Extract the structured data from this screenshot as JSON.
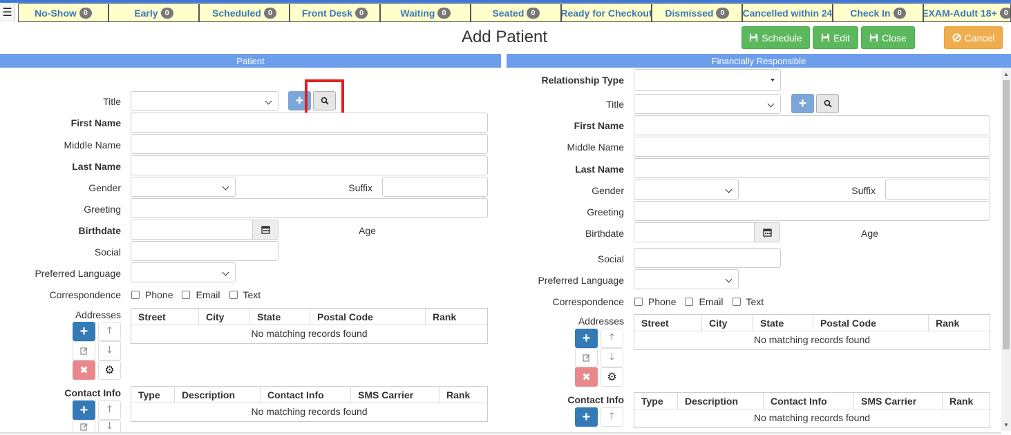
{
  "status_tabs": [
    {
      "label": "No-Show",
      "count": "0"
    },
    {
      "label": "Early",
      "count": "0"
    },
    {
      "label": "Scheduled",
      "count": "0"
    },
    {
      "label": "Front Desk",
      "count": "0"
    },
    {
      "label": "Waiting",
      "count": "0"
    },
    {
      "label": "Seated",
      "count": "0"
    },
    {
      "label": "Ready for Checkout",
      "count": ""
    },
    {
      "label": "Dismissed",
      "count": "0"
    },
    {
      "label": "Cancelled within 24",
      "count": ""
    },
    {
      "label": "Check In",
      "count": "0"
    },
    {
      "label": "EXAM-Adult 18+",
      "count": "0"
    }
  ],
  "page": {
    "title": "Add Patient",
    "menu_icon": "☰"
  },
  "actions": {
    "schedule": "Schedule",
    "edit": "Edit",
    "close": "Close",
    "cancel": "Cancel"
  },
  "sections": {
    "patient": "Patient",
    "financial": "Financially Responsible"
  },
  "patient": {
    "title": "Title",
    "first_name": "First Name",
    "middle_name": "Middle Name",
    "last_name": "Last Name",
    "gender": "Gender",
    "suffix": "Suffix",
    "greeting": "Greeting",
    "birthdate": "Birthdate",
    "age": "Age",
    "social": "Social",
    "preferred_language": "Preferred Language",
    "correspondence": "Correspondence",
    "corr_options": [
      "Phone",
      "Email",
      "Text"
    ],
    "addresses": "Addresses",
    "contact_info": "Contact Info"
  },
  "financial": {
    "relationship_type": "Relationship Type",
    "title": "Title",
    "first_name": "First Name",
    "middle_name": "Middle Name",
    "last_name": "Last Name",
    "gender": "Gender",
    "suffix": "Suffix",
    "greeting": "Greeting",
    "birthdate": "Birthdate",
    "age": "Age",
    "social": "Social",
    "preferred_language": "Preferred Language",
    "correspondence": "Correspondence",
    "corr_options": [
      "Phone",
      "Email",
      "Text"
    ],
    "addresses": "Addresses",
    "contact_info": "Contact Info"
  },
  "address_grid": {
    "columns": [
      "Street",
      "City",
      "State",
      "Postal Code",
      "Rank"
    ],
    "empty": "No matching records found"
  },
  "contact_grid": {
    "columns": [
      "Type",
      "Description",
      "Contact Info",
      "SMS Carrier",
      "Rank"
    ],
    "empty": "No matching records found"
  },
  "icons": {
    "plus": "+",
    "search": "search-icon",
    "calendar": "calendar-icon",
    "edit": "edit-icon",
    "delete": "✖",
    "up": "🡑",
    "down": "🡓",
    "settings": "⚙",
    "save": "save-icon",
    "ban": "ban-icon"
  },
  "colors": {
    "accent_blue": "#6d9eeb",
    "status_bg": "#ffffcc",
    "status_text": "#3e78b3",
    "green": "#5cb85c",
    "orange": "#f0ad4e",
    "highlight": "#e02020"
  }
}
